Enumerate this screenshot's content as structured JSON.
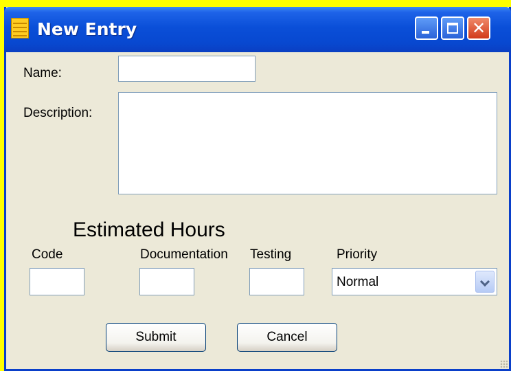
{
  "window": {
    "title": "New Entry",
    "colors": {
      "titlebar": "#0a4fd8",
      "client": "#ece9d8",
      "frame_background": "#ffff00"
    }
  },
  "form": {
    "name_label": "Name:",
    "name_value": "",
    "description_label": "Description:",
    "description_value": "",
    "estimated_hours_heading": "Estimated Hours",
    "code_label": "Code",
    "code_value": "",
    "documentation_label": "Documentation",
    "documentation_value": "",
    "testing_label": "Testing",
    "testing_value": "",
    "priority_label": "Priority",
    "priority_selected": "Normal"
  },
  "buttons": {
    "submit": "Submit",
    "cancel": "Cancel",
    "close_glyph": "✕"
  },
  "icons": [
    "app-icon",
    "minimize-icon",
    "maximize-icon",
    "close-icon",
    "chevron-down-icon",
    "resize-grip-icon"
  ]
}
